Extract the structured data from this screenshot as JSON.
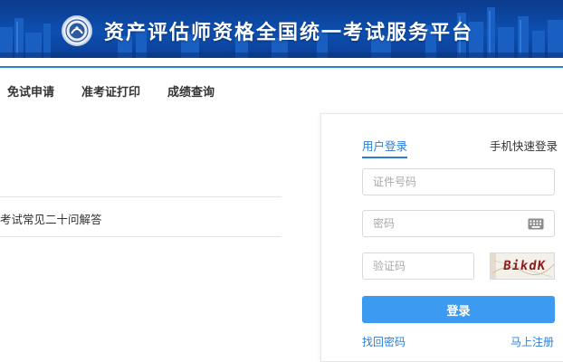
{
  "header": {
    "title": "资产评估师资格全国统一考试服务平台",
    "logo_icon": "association-seal-icon"
  },
  "nav": {
    "items": [
      {
        "label": "免试申请"
      },
      {
        "label": "准考证打印"
      },
      {
        "label": "成绩查询"
      }
    ]
  },
  "main": {
    "list": [
      {
        "label": "考试常见二十问解答"
      }
    ]
  },
  "login": {
    "tabs": {
      "user": "用户登录",
      "phone": "手机快速登录"
    },
    "id_placeholder": "证件号码",
    "password_placeholder": "密码",
    "captcha_placeholder": "验证码",
    "captcha_text": "BikdK",
    "submit_label": "登录",
    "forgot_label": "找回密码",
    "register_label": "马上注册"
  },
  "colors": {
    "accent": "#2a7fd8",
    "button": "#3c9bf0",
    "banner": "#0d4fb0"
  }
}
